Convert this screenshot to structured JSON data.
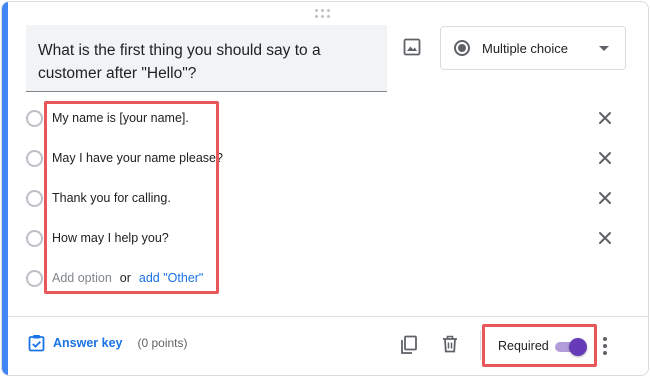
{
  "question": {
    "text": "What is the first thing you should say to a customer after \"Hello\"?"
  },
  "question_type": {
    "selected": "Multiple choice",
    "icon": "radio-button-icon"
  },
  "options": [
    {
      "label": "My name is [your name]."
    },
    {
      "label": "May I have your name please?"
    },
    {
      "label": "Thank you for calling."
    },
    {
      "label": "How may I help you?"
    }
  ],
  "add_option": {
    "label": "Add option",
    "or": "or",
    "add_other": "add \"Other\""
  },
  "footer": {
    "answer_key_label": "Answer key",
    "points": "(0 points)",
    "required_label": "Required",
    "required_on": true
  },
  "colors": {
    "accent": "#4285f4",
    "link": "#1a73e8",
    "toggle": "#673ab7",
    "highlight": "#e8575a"
  }
}
